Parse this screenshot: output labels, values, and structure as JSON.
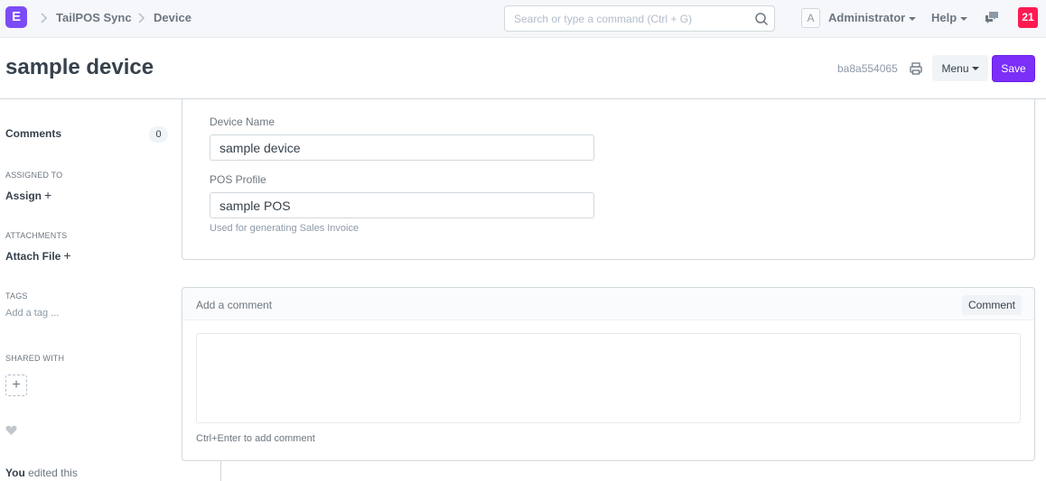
{
  "navbar": {
    "logo_letter": "E",
    "breadcrumbs": [
      "TailPOS Sync",
      "Device"
    ],
    "search_placeholder": "Search or type a command (Ctrl + G)",
    "avatar_letter": "A",
    "user_label": "Administrator",
    "help_label": "Help",
    "notification_count": "21"
  },
  "page": {
    "title": "sample device",
    "doc_id": "ba8a554065",
    "menu_label": "Menu",
    "save_label": "Save"
  },
  "sidebar": {
    "comments_label": "Comments",
    "comments_count": "0",
    "assigned_to_label": "ASSIGNED TO",
    "assign_label": "Assign",
    "attachments_label": "ATTACHMENTS",
    "attach_label": "Attach File",
    "tags_label": "TAGS",
    "add_tag_label": "Add a tag ...",
    "shared_with_label": "SHARED WITH",
    "plus": "+",
    "activity_user": "You",
    "activity_text": " edited this"
  },
  "form": {
    "device_name_label": "Device Name",
    "device_name_value": "sample device",
    "pos_profile_label": "POS Profile",
    "pos_profile_value": "sample POS",
    "pos_profile_help": "Used for generating Sales Invoice"
  },
  "comment": {
    "title": "Add a comment",
    "button_label": "Comment",
    "hint": "Ctrl+Enter to add comment"
  },
  "colors": {
    "brand": "#7b4cf6",
    "save": "#7b2ff7",
    "notification": "#ff1a52"
  }
}
